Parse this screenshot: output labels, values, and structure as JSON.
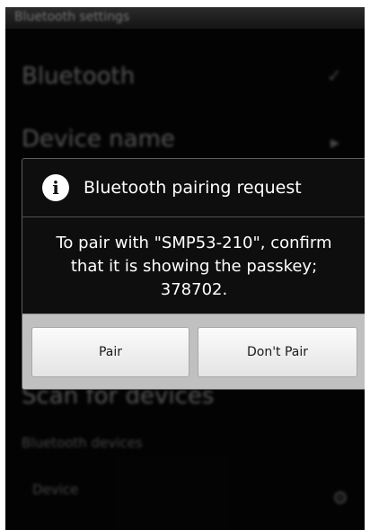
{
  "statusbar": {
    "text": "Bluetooth settings"
  },
  "settings": {
    "bluetooth_label": "Bluetooth",
    "device_name_label": "Device name",
    "scan_label": "Scan for devices",
    "bluetooth_devices_header": "Bluetooth devices",
    "device_label": "Device"
  },
  "dialog": {
    "icon": "info-icon",
    "title": "Bluetooth pairing request",
    "message": "To pair with \"SMP53-210\", confirm that it is showing the passkey; 378702.",
    "pair_label": "Pair",
    "dont_pair_label": "Don't Pair"
  }
}
